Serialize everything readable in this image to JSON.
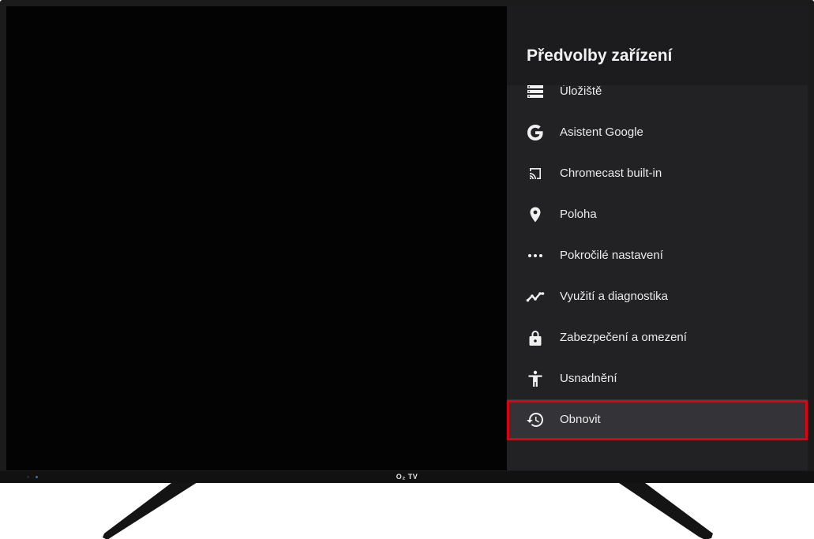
{
  "device": {
    "brand": "O₂ TV"
  },
  "panel": {
    "title": "Předvolby zařízení"
  },
  "menu": {
    "items": [
      {
        "label": "Úložiště",
        "icon": "storage-icon"
      },
      {
        "label": "Asistent Google",
        "icon": "google-icon"
      },
      {
        "label": "Chromecast built-in",
        "icon": "cast-icon"
      },
      {
        "label": "Poloha",
        "icon": "location-pin-icon"
      },
      {
        "label": "Pokročilé nastavení",
        "icon": "more-dots-icon"
      },
      {
        "label": "Využití a diagnostika",
        "icon": "trend-line-icon"
      },
      {
        "label": "Zabezpečení a omezení",
        "icon": "lock-icon"
      },
      {
        "label": "Usnadnění",
        "icon": "accessibility-icon"
      },
      {
        "label": "Obnovit",
        "icon": "restore-history-icon"
      }
    ],
    "selected_index": 8
  },
  "colors": {
    "highlight": "#e3000f",
    "panel_bg": "#222225",
    "selected_bg": "#343438",
    "led": "#2e6fd8"
  }
}
